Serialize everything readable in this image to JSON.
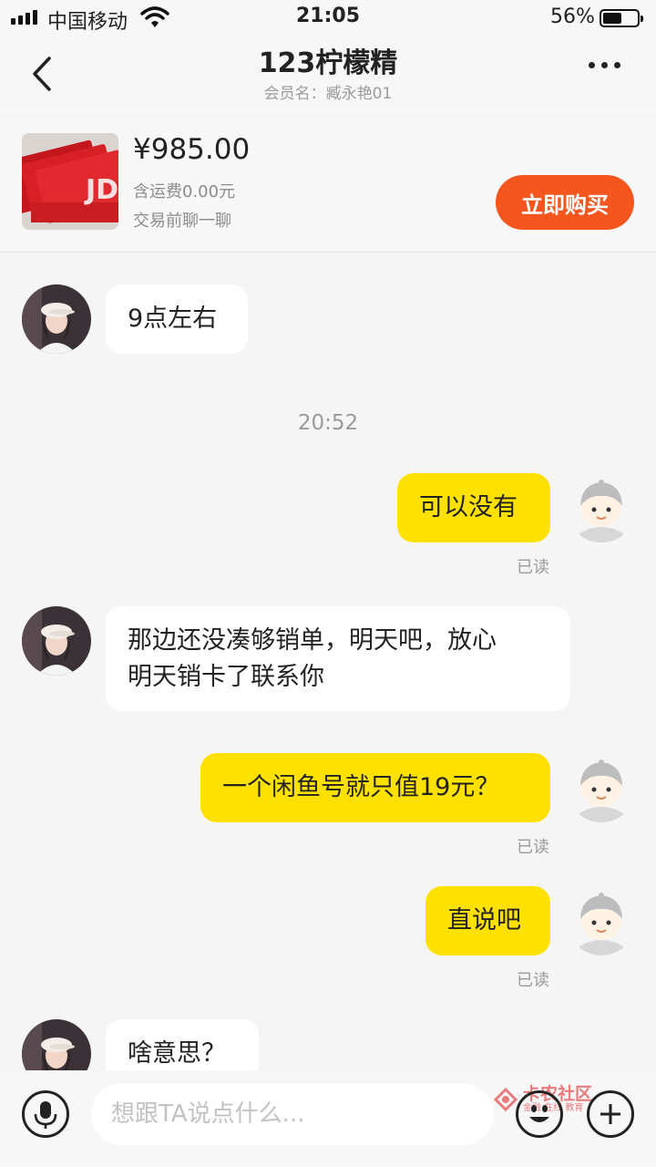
{
  "status_bar": {
    "carrier": "中国移动",
    "time": "21:05",
    "battery_percent": "56%",
    "battery_level": 0.56
  },
  "header": {
    "title": "123柠檬精",
    "subtitle": "会员名：臧永艳01"
  },
  "product": {
    "price": "¥985.00",
    "shipping": "含运费0.00元",
    "hint": "交易前聊一聊",
    "buy_label": "立即购买"
  },
  "messages": [
    {
      "side": "left",
      "text": "9点左右"
    },
    {
      "time": "20:52"
    },
    {
      "side": "right",
      "text": "可以没有",
      "status": "已读"
    },
    {
      "side": "left",
      "lines": [
        "那边还没凑够销单，明天吧，放心",
        "明天销卡了联系你"
      ]
    },
    {
      "side": "right",
      "text": "一个闲鱼号就只值19元？",
      "status": "已读"
    },
    {
      "side": "right",
      "text": "直说吧",
      "status": "已读"
    },
    {
      "side": "left",
      "text": "啥意思？"
    }
  ],
  "input": {
    "placeholder": "想跟TA说点什么..."
  },
  "watermark": {
    "title": "卡农社区",
    "subtitle": "金融 在线 教育"
  },
  "colors": {
    "accent_yellow": "#ffe100",
    "buy_orange": "#f4561e",
    "background": "#f5f5f5"
  }
}
